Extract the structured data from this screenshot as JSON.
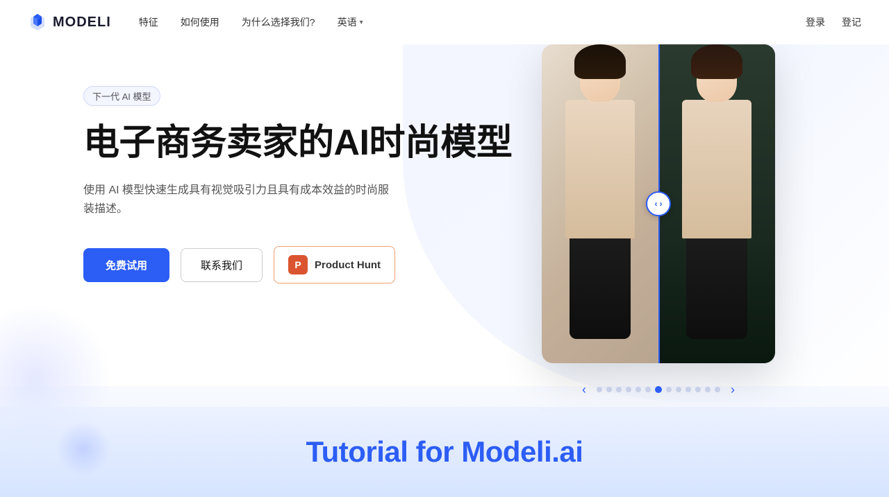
{
  "brand": {
    "logo_text": "MODELI",
    "logo_icon_unicode": "🔷"
  },
  "navbar": {
    "links": [
      {
        "id": "features",
        "label": "特征"
      },
      {
        "id": "how-to-use",
        "label": "如何使用"
      },
      {
        "id": "why-us",
        "label": "为什么选择我们?"
      },
      {
        "id": "language",
        "label": "英语",
        "has_dropdown": true
      }
    ],
    "actions": [
      {
        "id": "login",
        "label": "登录"
      },
      {
        "id": "register",
        "label": "登记"
      }
    ]
  },
  "hero": {
    "badge": "下一代 AI 模型",
    "title": "电子商务卖家的AI时尚模型",
    "subtitle": "使用 AI 模型快速生成具有视觉吸引力且具有成本效益的时尚服装描述。",
    "buttons": {
      "primary": "免费试用",
      "secondary": "联系我们",
      "producthunt": "Product Hunt"
    }
  },
  "carousel": {
    "total_dots": 13,
    "active_dot_index": 6,
    "arrow_left": "‹",
    "arrow_right": "›"
  },
  "tutorial": {
    "title": "Tutorial for Modeli.ai"
  }
}
